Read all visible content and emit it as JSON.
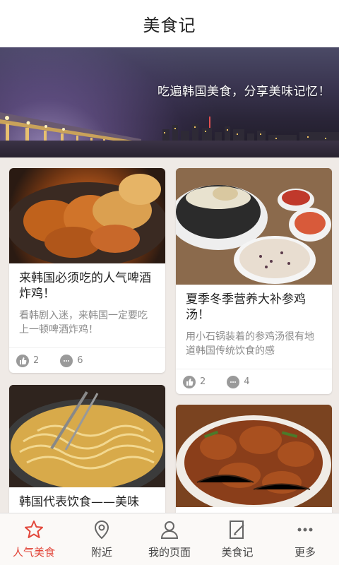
{
  "header": {
    "title": "美食记"
  },
  "banner": {
    "slogan": "吃遍韩国美食，分享美味记忆！"
  },
  "cards": [
    {
      "title": "来韩国必须吃的人气啤酒炸鸡！",
      "desc": "看韩剧入迷，来韩国一定要吃上一顿啤酒炸鸡！",
      "likes": "2",
      "comments": "6"
    },
    {
      "title": "夏季冬季营养大补参鸡汤！",
      "desc": "用小石锅装着的参鸡汤很有地道韩国传统饮食的感",
      "likes": "2",
      "comments": "4"
    },
    {
      "title": "韩国代表饮食——美味",
      "desc": "",
      "likes": "",
      "comments": ""
    },
    {
      "title": "",
      "desc": "",
      "likes": "",
      "comments": ""
    }
  ],
  "tabs": [
    {
      "label": "人气美食",
      "icon": "star-icon",
      "active": true
    },
    {
      "label": "附近",
      "icon": "location-pin-icon",
      "active": false
    },
    {
      "label": "我的页面",
      "icon": "user-icon",
      "active": false
    },
    {
      "label": "美食记",
      "icon": "note-edit-icon",
      "active": false
    },
    {
      "label": "更多",
      "icon": "more-dots-icon",
      "active": false
    }
  ],
  "colors": {
    "accent": "#e2463a",
    "background": "#efeae6"
  }
}
